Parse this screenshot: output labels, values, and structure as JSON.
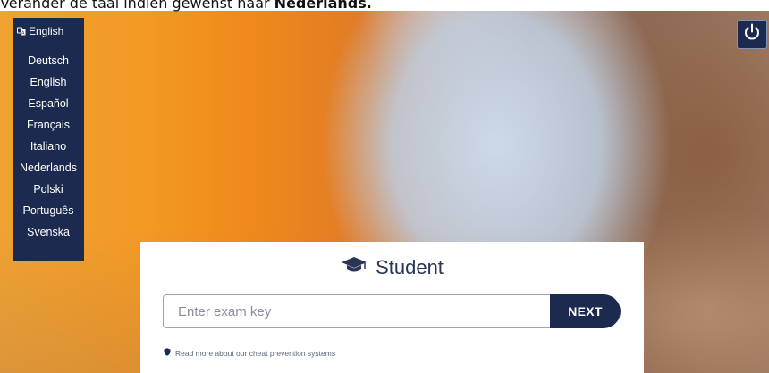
{
  "instruction": {
    "prefix": "Verander de taal indien gewenst naar ",
    "emphasis": "Nederlands."
  },
  "language_menu": {
    "current_label": "English",
    "items": [
      "Deutsch",
      "English",
      "Español",
      "Français",
      "Italiano",
      "Nederlands",
      "Polski",
      "Português",
      "Svenska"
    ]
  },
  "card": {
    "title": "Student",
    "exam_key_placeholder": "Enter exam key",
    "next_label": "NEXT",
    "cheat_link": "Read more about our cheat prevention systems"
  },
  "icons": {
    "language": "language-icon",
    "power": "power-icon",
    "title": "graduation-cap-icon",
    "cheat": "shield-icon"
  },
  "colors": {
    "navy": "#1b2a4e",
    "title_text": "#283555",
    "orange_background": "#ef8a1a"
  }
}
